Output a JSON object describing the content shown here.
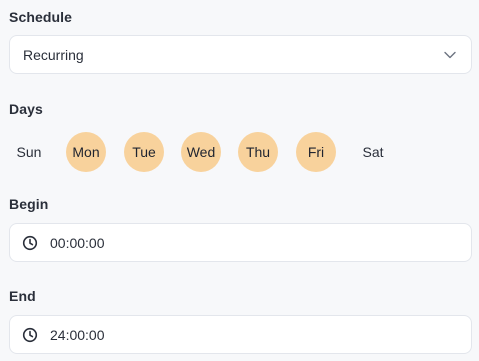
{
  "schedule": {
    "label": "Schedule",
    "value": "Recurring",
    "icon": "chevron-down-icon"
  },
  "days": {
    "label": "Days",
    "items": [
      {
        "label": "Sun",
        "selected": false
      },
      {
        "label": "Mon",
        "selected": true
      },
      {
        "label": "Tue",
        "selected": true
      },
      {
        "label": "Wed",
        "selected": true
      },
      {
        "label": "Thu",
        "selected": true
      },
      {
        "label": "Fri",
        "selected": true
      },
      {
        "label": "Sat",
        "selected": false
      }
    ],
    "selected_color": "#f8d29c"
  },
  "begin": {
    "label": "Begin",
    "value": "00:00:00",
    "icon": "clock-icon"
  },
  "end": {
    "label": "End",
    "value": "24:00:00",
    "icon": "clock-icon"
  }
}
